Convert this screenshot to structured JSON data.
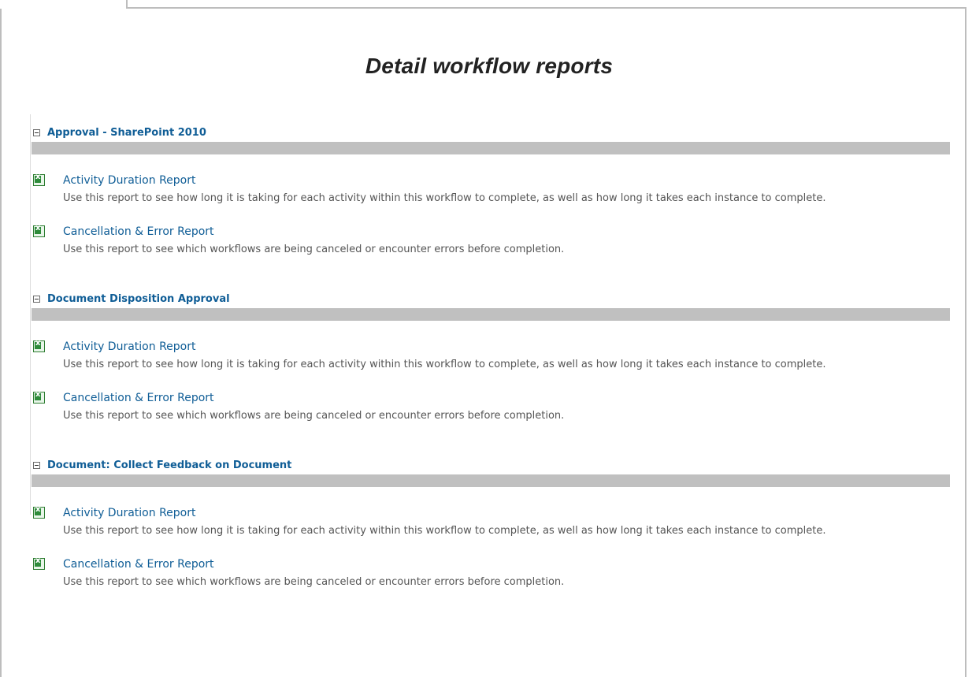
{
  "page": {
    "title": "Detail workflow reports"
  },
  "sections": [
    {
      "title": "Approval - SharePoint 2010",
      "reports": [
        {
          "title": "Activity Duration Report",
          "desc": "Use this report to see how long it is taking for each activity within this workflow to complete, as well as how long it takes each instance to complete."
        },
        {
          "title": "Cancellation & Error Report",
          "desc": "Use this report to see which workflows are being canceled or encounter errors before completion."
        }
      ]
    },
    {
      "title": "Document Disposition Approval",
      "reports": [
        {
          "title": "Activity Duration Report",
          "desc": "Use this report to see how long it is taking for each activity within this workflow to complete, as well as how long it takes each instance to complete."
        },
        {
          "title": "Cancellation & Error Report",
          "desc": "Use this report to see which workflows are being canceled or encounter errors before completion."
        }
      ]
    },
    {
      "title": "Document: Collect Feedback on Document",
      "reports": [
        {
          "title": "Activity Duration Report",
          "desc": "Use this report to see how long it is taking for each activity within this workflow to complete, as well as how long it takes each instance to complete."
        },
        {
          "title": "Cancellation & Error Report",
          "desc": "Use this report to see which workflows are being canceled or encounter errors before completion."
        }
      ]
    }
  ],
  "icons": {
    "collapse": "collapse-minus-icon",
    "excel": "excel-icon"
  },
  "colors": {
    "link": "#0f5d96",
    "bar": "#c0c0c0",
    "desc": "#555555"
  }
}
